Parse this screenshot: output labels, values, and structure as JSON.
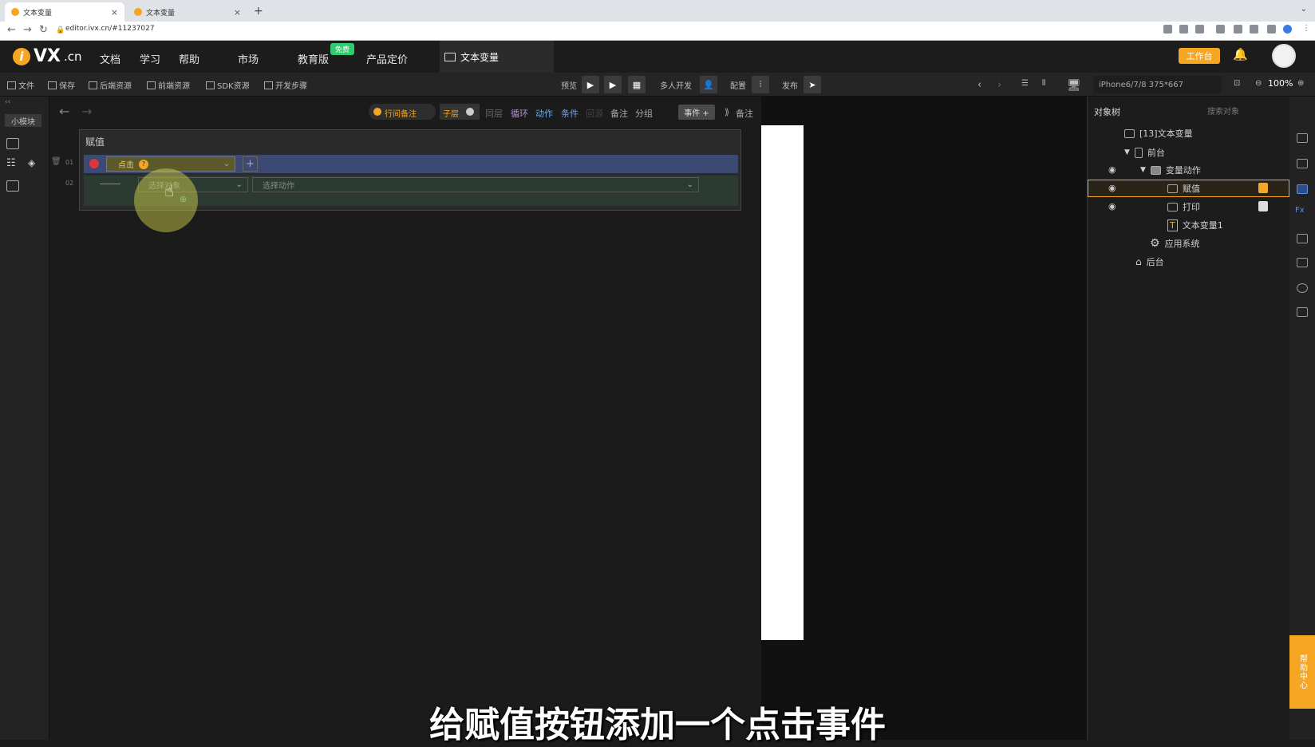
{
  "browser": {
    "tabs": [
      {
        "title": "文本变量",
        "close": "×"
      },
      {
        "title": "文本变量",
        "close": "×"
      }
    ],
    "new_tab": "+",
    "url": "editor.ivx.cn/#11237027"
  },
  "header": {
    "logo_text": "VX",
    "logo_suffix": ".cn",
    "menu": [
      "文档",
      "学习",
      "帮助",
      "市场",
      "教育版",
      "产品定价"
    ],
    "free_badge": "免费",
    "doc_tab": "文本变量",
    "workbench_label": "工作台"
  },
  "toolbar": {
    "file": "文件",
    "save": "保存",
    "backend_res": "后端资源",
    "frontend_res": "前端资源",
    "sdk_res": "SDK资源",
    "dev_steps": "开发步骤",
    "preview": "预览",
    "multi_dev": "多人开发",
    "config": "配置",
    "publish": "发布",
    "device": "iPhone6/7/8 375*667",
    "zoom": "100%"
  },
  "leftrail": {
    "mini_module": "小模块"
  },
  "editor": {
    "toolbar": {
      "row_comment": "行间备注",
      "child": "子层",
      "same_level": "同层",
      "loop": "循环",
      "action": "动作",
      "condition": "条件",
      "disabled": "回源",
      "comment": "备注",
      "group": "分组",
      "event_add": "事件 +",
      "comment2": "备注"
    },
    "panel_title": "赋值",
    "rows": [
      {
        "num": "01",
        "event": "点击"
      },
      {
        "num": "02",
        "target_placeholder": "选择对象",
        "action_placeholder": "选择动作"
      }
    ]
  },
  "tree": {
    "title": "对象树",
    "search_placeholder": "搜索对象",
    "nodes": [
      {
        "label": "[13]文本变量"
      },
      {
        "label": "前台"
      },
      {
        "label": "变量动作"
      },
      {
        "label": "赋值"
      },
      {
        "label": "打印"
      },
      {
        "label": "文本变量1"
      },
      {
        "label": "应用系统"
      },
      {
        "label": "后台"
      }
    ]
  },
  "help_center": "帮助中心",
  "subtitle": "给赋值按钮添加一个点击事件",
  "colors": {
    "accent": "#f5a623",
    "event_row": "#3c4a73",
    "action_row": "#2c3b32",
    "free_badge": "#2ecc71"
  }
}
